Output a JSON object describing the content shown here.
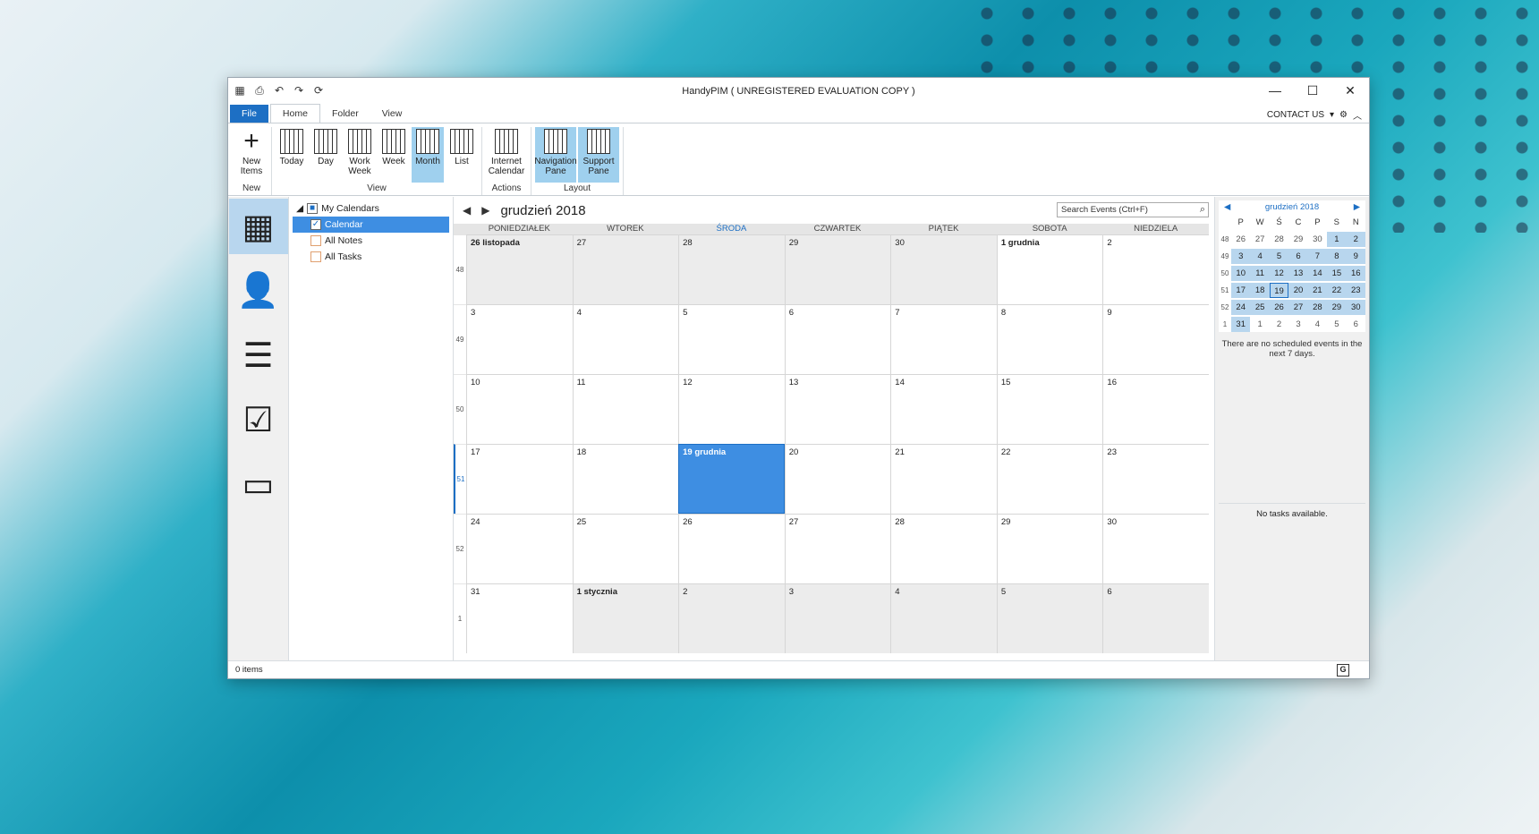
{
  "window": {
    "title": "HandyPIM ( UNREGISTERED EVALUATION COPY )"
  },
  "tabs": [
    "File",
    "Home",
    "Folder",
    "View"
  ],
  "contact_us": "CONTACT US",
  "ribbon": {
    "new_group": {
      "label": "New",
      "buttons": [
        {
          "label": "New Items"
        }
      ]
    },
    "view_group": {
      "label": "View",
      "buttons": [
        {
          "label": "Today"
        },
        {
          "label": "Day"
        },
        {
          "label": "Work Week"
        },
        {
          "label": "Week"
        },
        {
          "label": "Month"
        },
        {
          "label": "List"
        }
      ]
    },
    "actions_group": {
      "label": "Actions",
      "buttons": [
        {
          "label": "Internet Calendar"
        }
      ]
    },
    "layout_group": {
      "label": "Layout",
      "buttons": [
        {
          "label": "Navigation Pane"
        },
        {
          "label": "Support Pane"
        }
      ]
    }
  },
  "folders": {
    "root": "My Calendars",
    "items": [
      "Calendar",
      "All Notes",
      "All Tasks"
    ]
  },
  "calendar": {
    "month_title": "grudzień 2018",
    "search_placeholder": "Search Events (Ctrl+F)",
    "days": [
      "PONIEDZIAŁEK",
      "WTOREK",
      "ŚRODA",
      "CZWARTEK",
      "PIĄTEK",
      "SOBOTA",
      "NIEDZIELA"
    ],
    "weeks": [
      {
        "num": "48",
        "days": [
          "26 listopada",
          "27",
          "28",
          "29",
          "30",
          "1 grudnia",
          "2"
        ]
      },
      {
        "num": "49",
        "days": [
          "3",
          "4",
          "5",
          "6",
          "7",
          "8",
          "9"
        ]
      },
      {
        "num": "50",
        "days": [
          "10",
          "11",
          "12",
          "13",
          "14",
          "15",
          "16"
        ]
      },
      {
        "num": "51",
        "days": [
          "17",
          "18",
          "19 grudnia",
          "20",
          "21",
          "22",
          "23"
        ]
      },
      {
        "num": "52",
        "days": [
          "24",
          "25",
          "26",
          "27",
          "28",
          "29",
          "30"
        ]
      },
      {
        "num": "1",
        "days": [
          "31",
          "1 stycznia",
          "2",
          "3",
          "4",
          "5",
          "6"
        ]
      }
    ]
  },
  "mini_calendar": {
    "title": "grudzień 2018",
    "days": [
      "P",
      "W",
      "Ś",
      "C",
      "P",
      "S",
      "N"
    ],
    "weeks": [
      {
        "num": "48",
        "days": [
          "26",
          "27",
          "28",
          "29",
          "30",
          "1",
          "2"
        ]
      },
      {
        "num": "49",
        "days": [
          "3",
          "4",
          "5",
          "6",
          "7",
          "8",
          "9"
        ]
      },
      {
        "num": "50",
        "days": [
          "10",
          "11",
          "12",
          "13",
          "14",
          "15",
          "16"
        ]
      },
      {
        "num": "51",
        "days": [
          "17",
          "18",
          "19",
          "20",
          "21",
          "22",
          "23"
        ]
      },
      {
        "num": "52",
        "days": [
          "24",
          "25",
          "26",
          "27",
          "28",
          "29",
          "30"
        ]
      },
      {
        "num": "1",
        "days": [
          "31",
          "1",
          "2",
          "3",
          "4",
          "5",
          "6"
        ]
      }
    ],
    "no_events": "There are no scheduled events in the next 7 days.",
    "no_tasks": "No tasks available."
  },
  "status": {
    "items": "0 items"
  }
}
